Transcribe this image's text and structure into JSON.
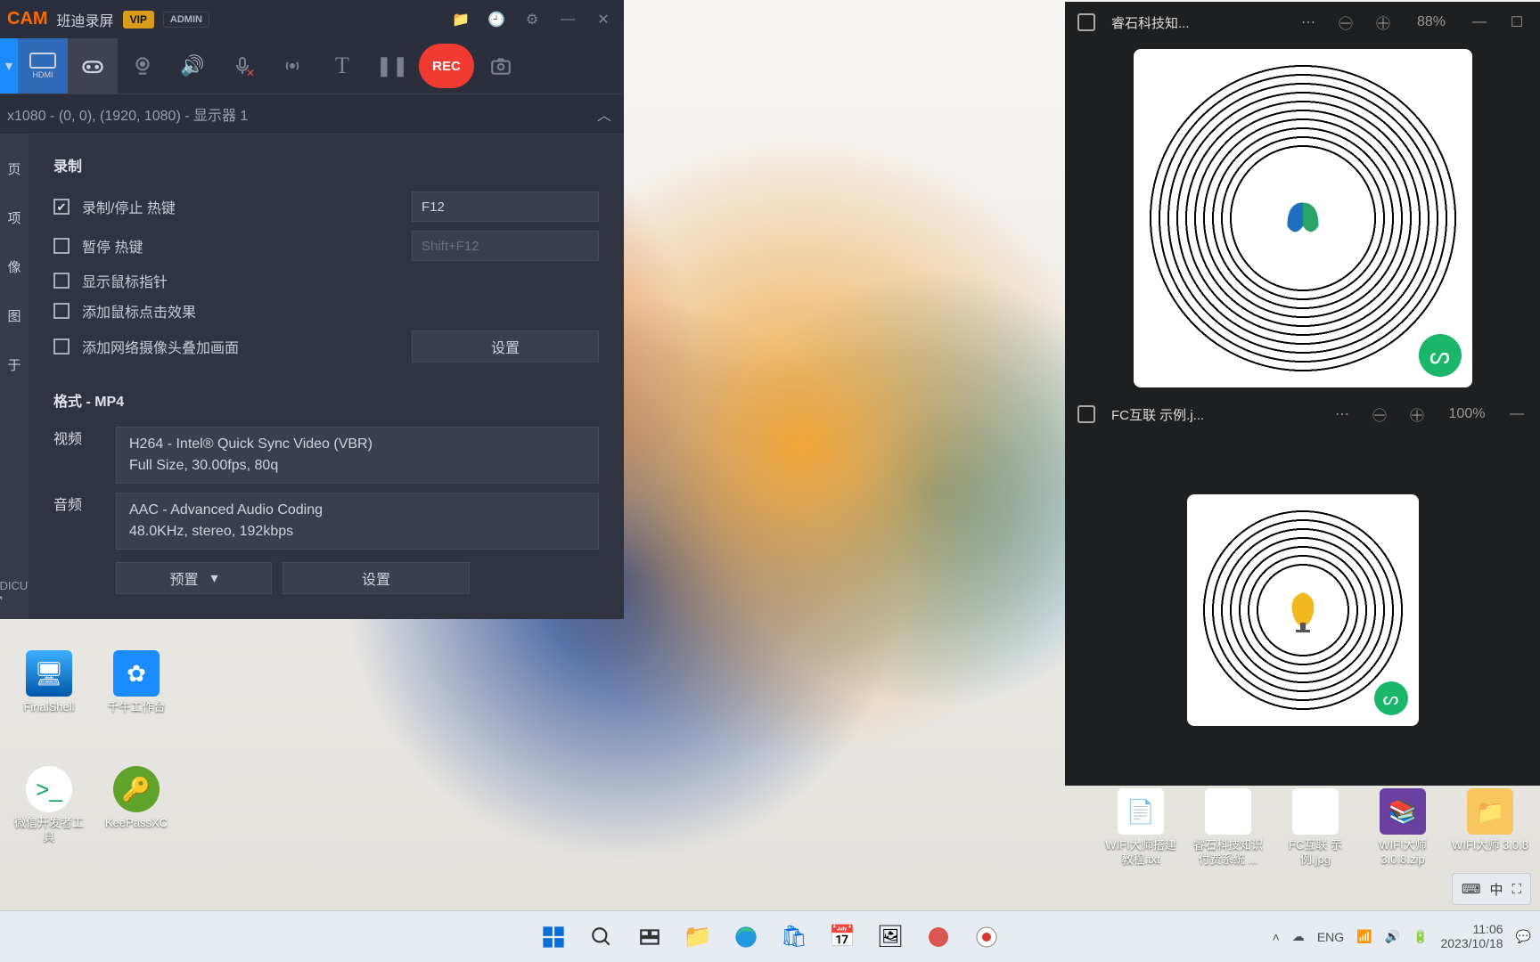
{
  "bandicam": {
    "logo": "CAM",
    "name": "班迪录屏",
    "vip": "VIP",
    "admin": "ADMIN",
    "rec": "REC",
    "display_info": "x1080 - (0, 0), (1920, 1080) - 显示器 1",
    "sidebar": [
      "页",
      "项",
      "像",
      "图",
      "于"
    ],
    "sidebar_bottom": "JDICUT ↗",
    "section_record": "录制",
    "opt_record_hotkey": "录制/停止 热键",
    "opt_pause_hotkey": "暂停 热键",
    "opt_cursor": "显示鼠标指针",
    "opt_click_fx": "添加鼠标点击效果",
    "opt_webcam_overlay": "添加网络摄像头叠加画面",
    "hotkey_record": "F12",
    "hotkey_pause": "Shift+F12",
    "btn_settings": "设置",
    "section_format": "格式 - MP4",
    "lbl_video": "视频",
    "lbl_audio": "音频",
    "video_line1": "H264 - Intel® Quick Sync Video (VBR)",
    "video_line2": "Full Size, 30.00fps, 80q",
    "audio_line1": "AAC - Advanced Audio Coding",
    "audio_line2": "48.0KHz, stereo, 192kbps",
    "btn_preset": "预置"
  },
  "viewers": {
    "v1": {
      "title": "睿石科技知...",
      "zoom": "88%"
    },
    "v2": {
      "title": "FC互联 示例.j...",
      "zoom": "100%"
    }
  },
  "desktop_icons": {
    "finalshell": "FinalShell",
    "qianniu": "千牛工作台",
    "wx_dev": "微信开发者工具",
    "keepass": "KeePassXC",
    "wifi_tutorial": "WIFI大师搭建教程.txt",
    "ruishi": "睿石科技知识付费系统 ...",
    "fclian": "FC互联 示例.jpg",
    "wifi_zip": "WIFI大师 3.0.8.zip",
    "wifi_folder": "WIFI大师 3.0.8"
  },
  "lang_tray": {
    "ime1": "⌨",
    "ime2": "中",
    "ime3": "⛶"
  },
  "taskbar": {
    "time": "11:06",
    "date": "2023/10/18"
  }
}
